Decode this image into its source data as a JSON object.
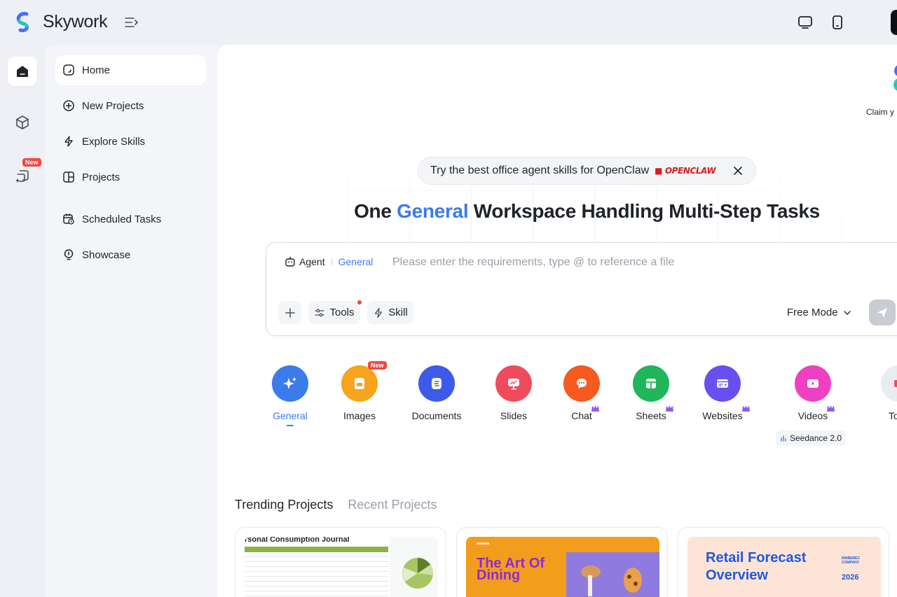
{
  "app": {
    "name": "Skywork"
  },
  "rail": {
    "new_badge": "New"
  },
  "sidebar": {
    "items": [
      {
        "label": "Home",
        "icon": "home-icon"
      },
      {
        "label": "New Projects",
        "icon": "plus-circle-icon"
      },
      {
        "label": "Explore Skills",
        "icon": "lightning-icon"
      },
      {
        "label": "Projects",
        "icon": "grid-icon"
      },
      {
        "label": "Scheduled Tasks",
        "icon": "calendar-clock-icon"
      },
      {
        "label": "Showcase",
        "icon": "lightbulb-icon"
      }
    ]
  },
  "claim": {
    "text": "Claim y"
  },
  "promo": {
    "text": "Try the best office agent skills for OpenClaw",
    "brand": "OPENCLAW"
  },
  "headline": {
    "before": "One ",
    "accent": "General",
    "after": " Workspace Handling Multi-Step Tasks"
  },
  "composer": {
    "agent_label": "Agent",
    "mode_label": "General",
    "placeholder": "Please enter the requirements, type @ to reference a file",
    "tools_label": "Tools",
    "skill_label": "Skill",
    "free_mode_label": "Free Mode"
  },
  "categories": [
    {
      "label": "General",
      "color": "#3b7bec",
      "icon": "sparkle-icon",
      "active": true
    },
    {
      "label": "Images",
      "color": "#f7a41c",
      "icon": "image-icon",
      "badge": "New"
    },
    {
      "label": "Documents",
      "color": "#3d5be8",
      "icon": "document-icon"
    },
    {
      "label": "Slides",
      "color": "#f04b5d",
      "icon": "slides-icon"
    },
    {
      "label": "Chat",
      "color": "#f55a1f",
      "icon": "chat-icon",
      "crown": true
    },
    {
      "label": "Sheets",
      "color": "#20b65a",
      "icon": "sheet-icon",
      "crown": true
    },
    {
      "label": "Websites",
      "color": "#6a4ff0",
      "icon": "website-icon",
      "crown": true
    },
    {
      "label": "Videos",
      "color": "#f03fc4",
      "icon": "video-icon",
      "crown": true
    },
    {
      "label": "To",
      "color": "#e9edf0",
      "icon": "tool-icon"
    }
  ],
  "seedance": {
    "label": "Seedance 2.0"
  },
  "tabs": [
    {
      "label": "Trending Projects",
      "active": true
    },
    {
      "label": "Recent Projects",
      "active": false
    }
  ],
  "projects": [
    {
      "thumb_title": "rsonal Consumption Journal"
    },
    {
      "thumb_title": "The Art Of Dining"
    },
    {
      "thumb_title": "Retail Forecast Overview",
      "thumb_small": "RINBEREC COMPANY",
      "thumb_year": "2026"
    }
  ]
}
